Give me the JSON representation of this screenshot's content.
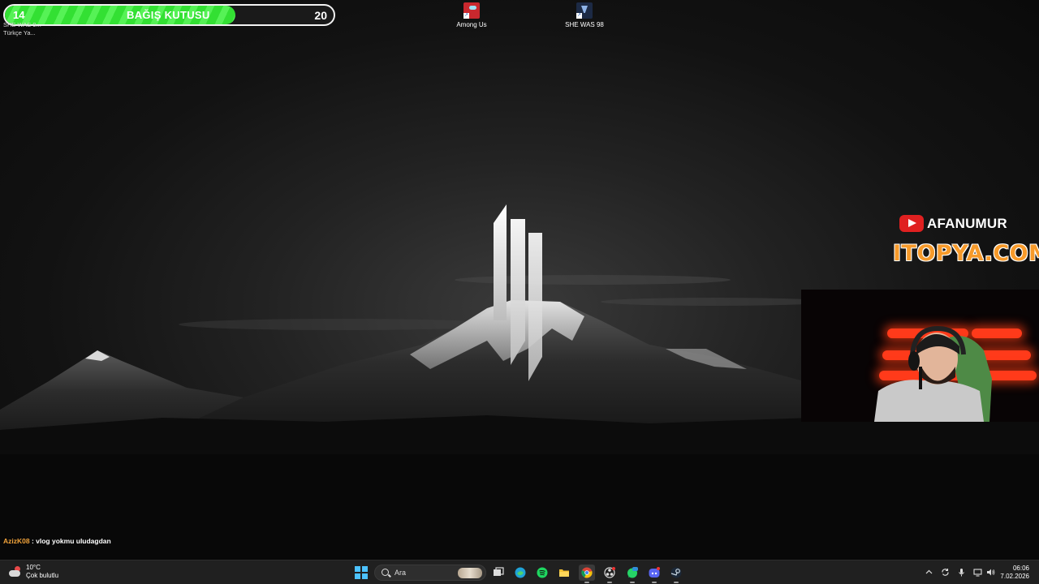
{
  "donation_widget": {
    "current": "14",
    "label": "BAĞIŞ KUTUSU",
    "goal": "20",
    "progress_fraction": 0.7,
    "fill_color": "#33e033"
  },
  "partial_shortcut_label": {
    "line1": "SHE WAS 9...",
    "line2": "Türkçe Ya..."
  },
  "desktop_icons": [
    {
      "label": "Among Us",
      "icon": "among-us-icon"
    },
    {
      "label": "SHE WAS 98",
      "icon": "she-was-98-icon"
    }
  ],
  "overlay": {
    "channel_name": "AFANUMUR",
    "channel_icon": "youtube-icon",
    "sponsor": "ITOPYA.COM",
    "sponsor_color": "#f79a2a"
  },
  "chat": {
    "user": "AzizK08",
    "separator": " : ",
    "message": "vlog yokmu uludagdan",
    "user_color": "#f3a43b"
  },
  "taskbar": {
    "weather": {
      "temperature": "10°C",
      "condition": "Çok bulutlu",
      "icon": "cloud-icon"
    },
    "search_placeholder": "Ara",
    "apps": [
      "task-view-icon",
      "edge-icon",
      "spotify-icon",
      "file-explorer-icon",
      "chrome-icon",
      "obs-icon",
      "whatsapp-icon",
      "discord-icon",
      "steam-icon"
    ],
    "tray_icons": [
      "chevron-up-icon",
      "sync-icon",
      "microphone-icon",
      "display-icon",
      "volume-icon"
    ],
    "clock": {
      "time": "06:06",
      "date": "7.02.2026"
    },
    "accent_color": "#4cc2ff"
  }
}
